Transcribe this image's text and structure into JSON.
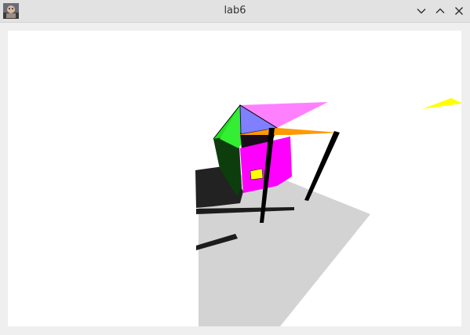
{
  "window": {
    "title": "lab6",
    "icon": "app-thumbnail-icon",
    "controls": {
      "minimize_icon": "chevron-down-icon",
      "maximize_icon": "chevron-up-icon",
      "close_icon": "close-icon"
    }
  },
  "scene": {
    "background": "#ffffff",
    "floor_color": "#d3d3d3",
    "shadow_color": "#1e1e1e",
    "colors": {
      "magenta": "#ff00ff",
      "pink": "#ff80ff",
      "blue_violet": "#8080ff",
      "green": "#00ff00",
      "dark_green": "#0a3a0a",
      "orange": "#ff9900",
      "yellow": "#ffff00",
      "black": "#000000"
    }
  }
}
